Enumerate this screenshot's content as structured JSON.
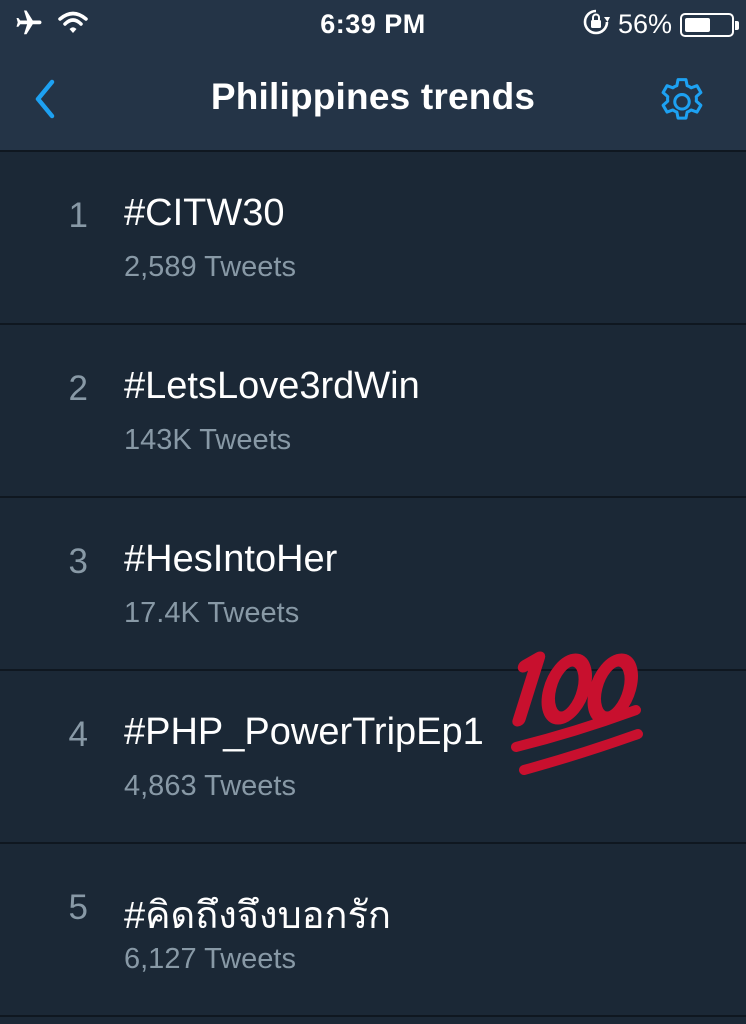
{
  "status_bar": {
    "time": "6:39 PM",
    "battery_percent": "56%",
    "battery_level": 0.56,
    "icons": [
      "airplane-icon",
      "wifi-icon",
      "orientation-lock-icon",
      "battery-icon"
    ]
  },
  "nav": {
    "title": "Philippines trends",
    "back_icon": "chevron-left-icon",
    "settings_icon": "gear-icon"
  },
  "colors": {
    "background": "#1b2836",
    "bar": "#243447",
    "accent": "#1da1f2",
    "secondary_text": "#8899a6",
    "divider": "#0f1720",
    "emoji_red": "#c8102e"
  },
  "trends": [
    {
      "rank": "1",
      "name": "#CITW30",
      "count": "2,589 Tweets"
    },
    {
      "rank": "2",
      "name": "#LetsLove3rdWin",
      "count": "143K Tweets"
    },
    {
      "rank": "3",
      "name": "#HesIntoHer",
      "count": "17.4K Tweets"
    },
    {
      "rank": "4",
      "name": "#PHP_PowerTripEp1",
      "count": "4,863 Tweets"
    },
    {
      "rank": "5",
      "name": "#คิดถึงจึงบอกรัก",
      "count": "6,127 Tweets"
    }
  ],
  "overlay": {
    "emoji": "hundred-points-icon"
  }
}
